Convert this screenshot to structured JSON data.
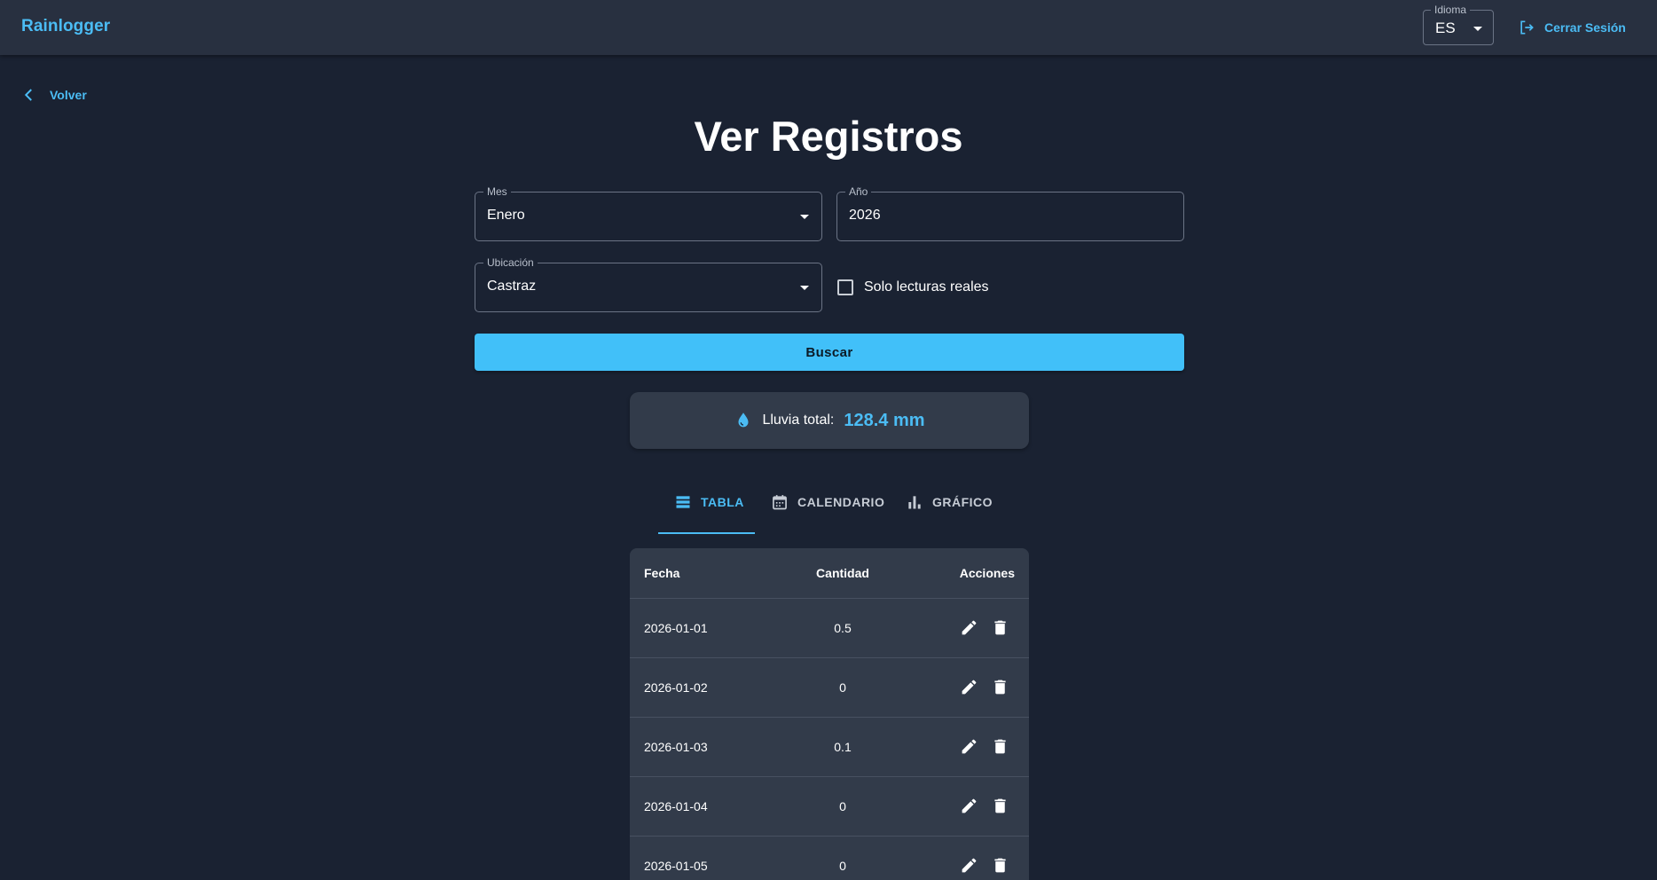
{
  "header": {
    "brand": "Rainlogger",
    "language_label": "Idioma",
    "language_value": "ES",
    "logout_label": "Cerrar Sesión"
  },
  "nav": {
    "back_label": "Volver"
  },
  "page": {
    "title": "Ver Registros"
  },
  "filters": {
    "month_label": "Mes",
    "month_value": "Enero",
    "year_label": "Año",
    "year_value": "2026",
    "location_label": "Ubicación",
    "location_value": "Castraz",
    "real_only_label": "Solo lecturas reales",
    "real_only_checked": false,
    "search_label": "Buscar"
  },
  "summary": {
    "label": "Lluvia total:",
    "value": "128.4 mm"
  },
  "tabs": [
    {
      "label": "TABLA",
      "icon": "list-icon",
      "active": true
    },
    {
      "label": "CALENDARIO",
      "icon": "calendar-icon",
      "active": false
    },
    {
      "label": "GRÁFICO",
      "icon": "bar-chart-icon",
      "active": false
    }
  ],
  "table": {
    "columns": [
      "Fecha",
      "Cantidad",
      "Acciones"
    ],
    "rows": [
      {
        "date": "2026-01-01",
        "amount": "0.5"
      },
      {
        "date": "2026-01-02",
        "amount": "0"
      },
      {
        "date": "2026-01-03",
        "amount": "0.1"
      },
      {
        "date": "2026-01-04",
        "amount": "0"
      },
      {
        "date": "2026-01-05",
        "amount": "0"
      }
    ]
  },
  "colors": {
    "accent": "#4bbcf4",
    "button": "#41c0f9",
    "background": "#1a2232",
    "appbar": "#283040",
    "card": "#323b4a"
  }
}
